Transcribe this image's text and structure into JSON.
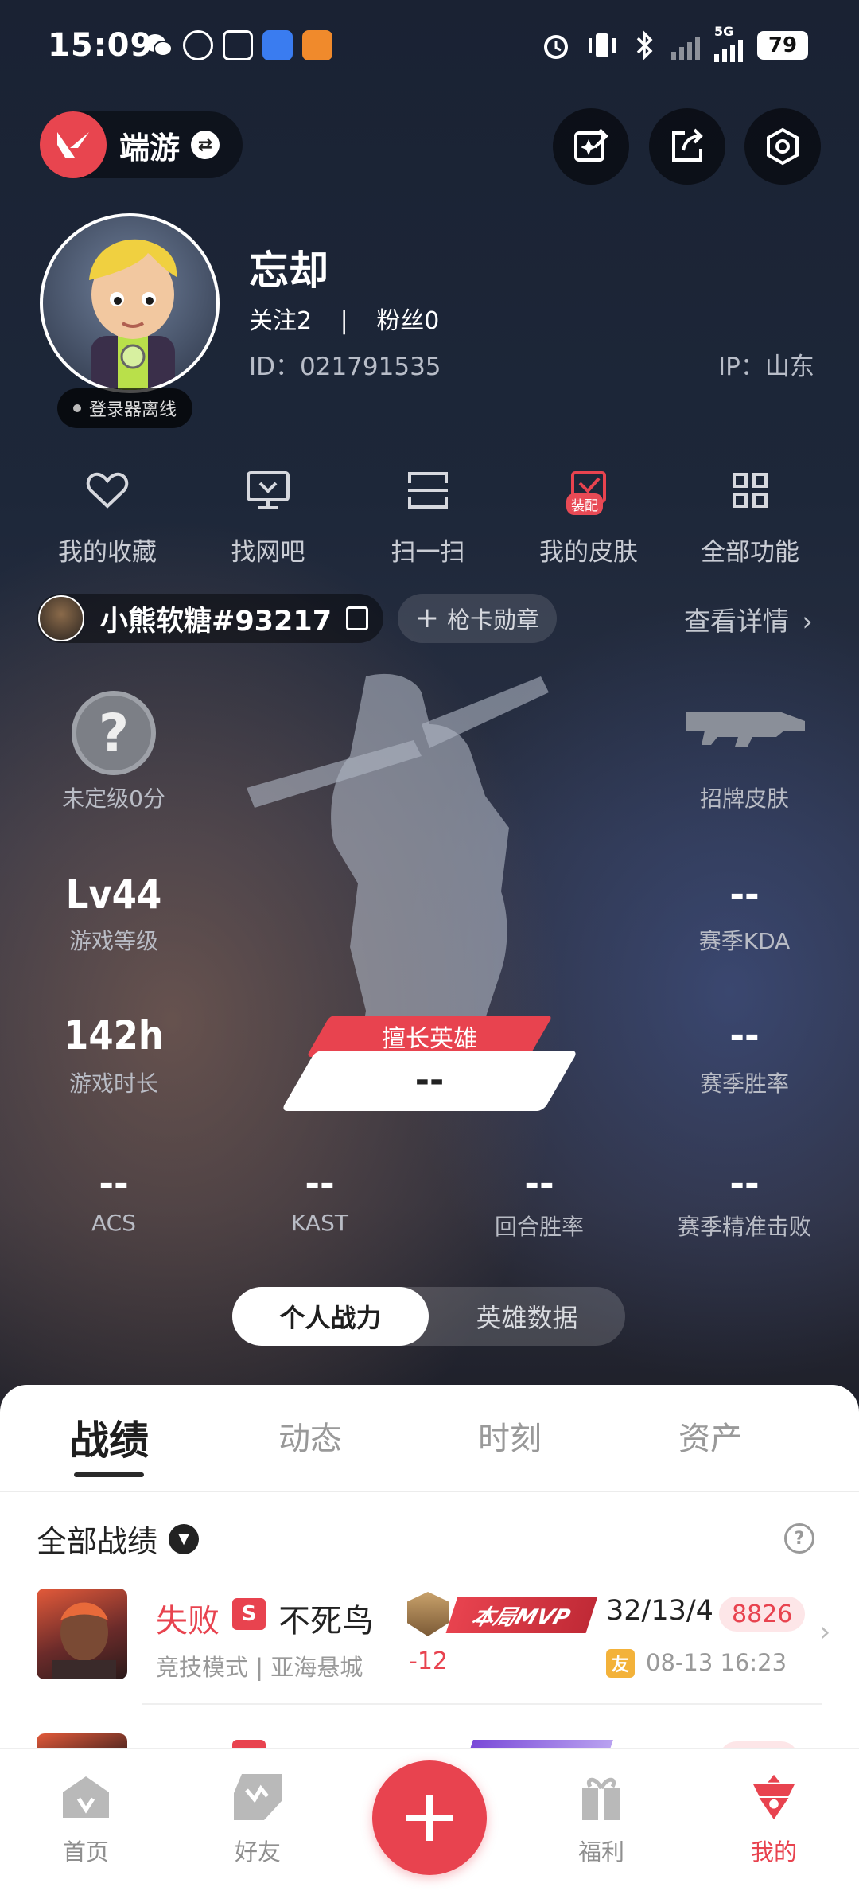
{
  "status_bar": {
    "time": "15:09",
    "network": "5G",
    "battery": "79"
  },
  "header": {
    "game_name": "端游",
    "icons": [
      "valorant-logo-icon",
      "swap-icon",
      "edit-sparkle-icon",
      "share-icon",
      "settings-hex-icon"
    ]
  },
  "profile": {
    "name": "忘却",
    "follow_text": "关注2",
    "fans_text": "粉丝0",
    "separator": "|",
    "id_text": "ID：021791535",
    "ip_text": "IP：山东",
    "login_status": "登录器离线"
  },
  "shortcuts": [
    {
      "label": "我的收藏",
      "icon": "heart-icon"
    },
    {
      "label": "找网吧",
      "icon": "monitor-icon"
    },
    {
      "label": "扫一扫",
      "icon": "scan-icon"
    },
    {
      "label": "我的皮肤",
      "icon": "skin-icon",
      "badge": "装配"
    },
    {
      "label": "全部功能",
      "icon": "grid-icon"
    }
  ],
  "riot": {
    "name": "小熊软糖#93217",
    "card_button": "枪卡勋章",
    "detail_link": "查看详情"
  },
  "stats": {
    "rank_label": "未定级0分",
    "rank_icon_text": "?",
    "skin_label": "招牌皮肤",
    "level_value": "Lv44",
    "level_label": "游戏等级",
    "kda_value": "--",
    "kda_label": "赛季KDA",
    "time_value": "142h",
    "time_label": "游戏时长",
    "winrate_value": "--",
    "winrate_label": "赛季胜率",
    "fav_hero_tag": "擅长英雄",
    "fav_hero_value": "--",
    "bottom": [
      {
        "value": "--",
        "label": "ACS"
      },
      {
        "value": "--",
        "label": "KAST"
      },
      {
        "value": "--",
        "label": "回合胜率"
      },
      {
        "value": "--",
        "label": "赛季精准击败"
      }
    ]
  },
  "segment": {
    "left": "个人战力",
    "right": "英雄数据"
  },
  "tabs": [
    "战绩",
    "动态",
    "时刻",
    "资产"
  ],
  "records": {
    "filter_label": "全部战绩",
    "matches": [
      {
        "result": "失败",
        "badge": "S",
        "agent": "不死鸟",
        "mode": "竞技模式 | 亚海悬城",
        "rank_delta": "-12",
        "mvp": "本局MVP",
        "kda": "32/13/4",
        "score": "8826",
        "friend_tag": "友",
        "date": "08-13 16:23"
      }
    ]
  },
  "bottom_nav": [
    {
      "label": "首页",
      "icon": "home-icon"
    },
    {
      "label": "好友",
      "icon": "friends-icon"
    },
    {
      "label": "",
      "icon": "plus-icon"
    },
    {
      "label": "福利",
      "icon": "gift-icon"
    },
    {
      "label": "我的",
      "icon": "profile-icon"
    }
  ],
  "colors": {
    "accent": "#e8434f",
    "mvp_gradient_start": "#e8434f",
    "gold": "#f3b23a"
  }
}
